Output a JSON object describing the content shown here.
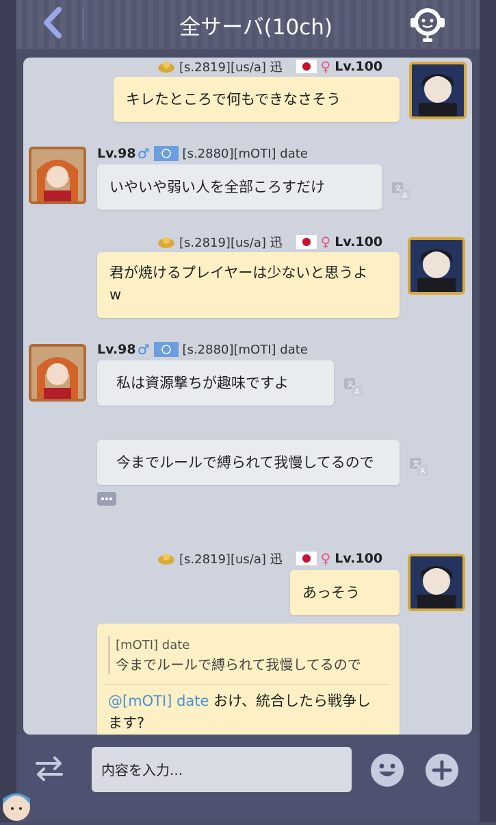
{
  "header": {
    "title": "全サーバ(10ch)"
  },
  "messages": [
    {
      "id": "m1",
      "side": "mine",
      "server": "[s.2819][us/a] 迅",
      "level": "Lv.100",
      "text": "キレたところで何もできなさそう"
    },
    {
      "id": "m2",
      "side": "theirs",
      "server": "[s.2880][mOTI] date",
      "level": "Lv.98",
      "text": "いやいや弱い人を全部ころすだけ"
    },
    {
      "id": "m3",
      "side": "mine",
      "server": "[s.2819][us/a] 迅",
      "level": "Lv.100",
      "text_line1": "君が焼けるプレイヤーは少ないと思うよ",
      "text_line2": "w"
    },
    {
      "id": "m4",
      "side": "theirs",
      "server": "[s.2880][mOTI] date",
      "level": "Lv.98",
      "text": "私は資源撃ちが趣味ですよ"
    },
    {
      "id": "m5",
      "side": "theirs",
      "text": "今までルールで縛られて我慢してるので"
    },
    {
      "id": "m6",
      "side": "mine",
      "server": "[s.2819][us/a] 迅",
      "level": "Lv.100",
      "text": "あっそう"
    },
    {
      "id": "m7",
      "side": "mine",
      "quote_author": "[mOTI] date",
      "quote_text": "今までルールで縛られて我慢してるので",
      "mention": "@[mOTI] date",
      "text_line1": " おけ、統合したら戦争し",
      "text_line2": "ます?"
    }
  ],
  "footer": {
    "input_placeholder": "内容を入力..."
  },
  "colors": {
    "mine_bubble": "#fdf0c4",
    "theirs_bubble": "#e9ecef",
    "chat_bg": "#cfd3de",
    "mention": "#4a8fd8",
    "male": "#3f8ee0",
    "female": "#e05a84"
  }
}
